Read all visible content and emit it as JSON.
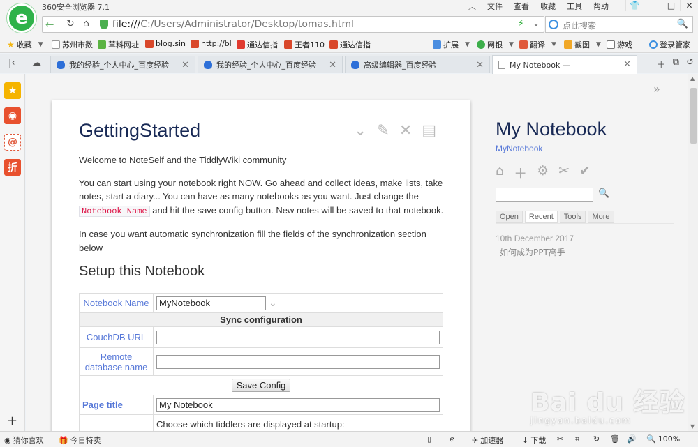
{
  "app": {
    "title": "360安全浏览器 7.1"
  },
  "title_menu": [
    "文件",
    "查看",
    "收藏",
    "工具",
    "帮助"
  ],
  "address": {
    "url_prefix": "file:///",
    "url_rest": "C:/Users/Administrator/Desktop/tomas.html"
  },
  "search": {
    "placeholder": "点此搜索"
  },
  "bookmarks": {
    "left": [
      "收藏",
      "苏州市数",
      "草料网址",
      "blog.sin",
      "http://bl",
      "通达信指",
      "王者110",
      "通达信指"
    ],
    "right": [
      "扩展",
      "网银",
      "翻译",
      "截图",
      "游戏",
      "登录管家"
    ]
  },
  "tabs": [
    {
      "label": "我的经验_个人中心_百度经验"
    },
    {
      "label": "我的经验_个人中心_百度经验"
    },
    {
      "label": "高级编辑器_百度经验"
    },
    {
      "label": "My Notebook —"
    }
  ],
  "tiddler": {
    "title": "GettingStarted",
    "p1": "Welcome to NoteSelf and the TiddlyWiki community",
    "p2a": "You can start using your notebook right NOW. Go ahead and collect ideas, make lists, take notes, start a diary... You can have as many notebooks as you want. Just change the",
    "p2code": "Notebook Name",
    "p2b": "and hit the save config button. New notes will be saved to that notebook.",
    "p3": "In case you want automatic synchronization fill the fields of the synchronization section below",
    "h2": "Setup this Notebook",
    "notebook_name_label": "Notebook Name",
    "notebook_name_value": "MyNotebook",
    "sync_header": "Sync configuration",
    "couchdb_label": "CouchDB URL",
    "remote_db_label": "Remote database name",
    "save_label": "Save Config",
    "page_title_label": "Page title",
    "page_title_value": "My Notebook",
    "startup_text": "Choose which tiddlers are displayed at startup:"
  },
  "sidebar": {
    "title": "My Notebook",
    "subtitle": "MyNotebook",
    "tabs": [
      "Open",
      "Recent",
      "Tools",
      "More"
    ],
    "active_tab": "Recent",
    "date": "10th December 2017",
    "item": "如何成为PPT高手"
  },
  "status": {
    "left": [
      "猜你喜欢",
      "今日特卖"
    ],
    "right": [
      "加速器",
      "下载",
      "100%"
    ]
  },
  "watermark": {
    "main": "Bai du 经验",
    "sub": "jingyan.baidu.com"
  },
  "colors": {
    "accent": "#182955",
    "link": "#5778d8",
    "brand_green": "#2fb24a"
  }
}
